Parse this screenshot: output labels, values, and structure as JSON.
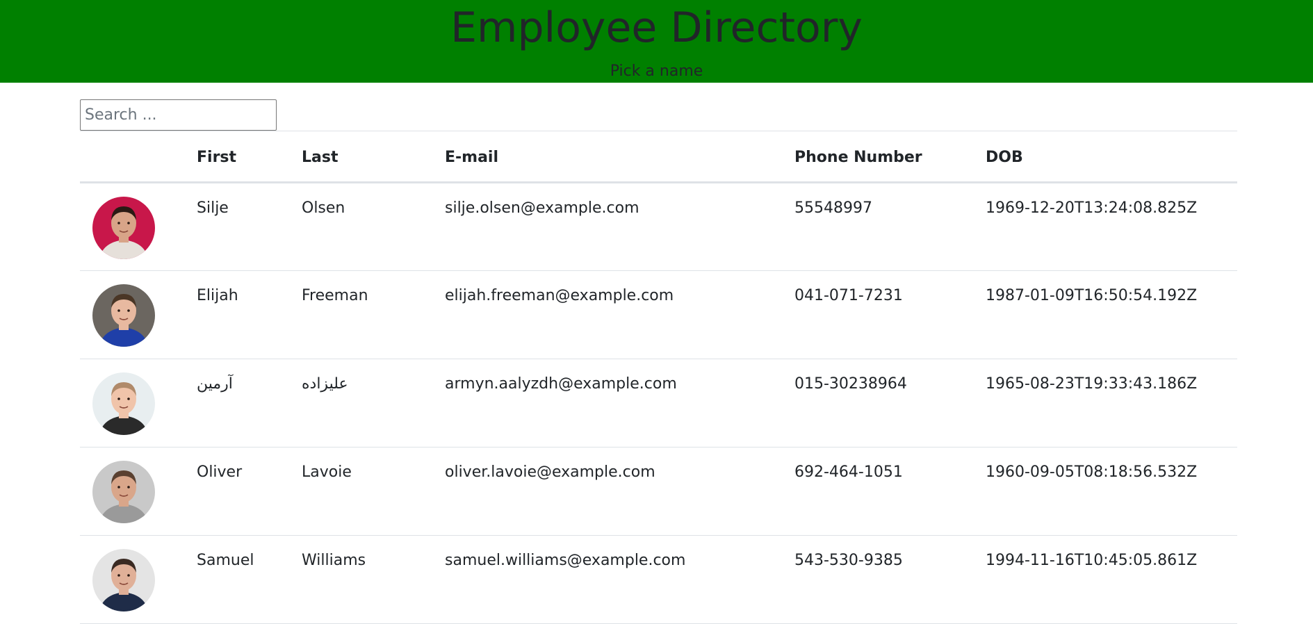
{
  "header": {
    "title": "Employee Directory",
    "subtitle": "Pick a name"
  },
  "search": {
    "placeholder": "Search ...",
    "value": ""
  },
  "table": {
    "columns": [
      "",
      "First",
      "Last",
      "E-mail",
      "Phone Number",
      "DOB"
    ],
    "rows": [
      {
        "first": "Silje",
        "last": "Olsen",
        "email": "silje.olsen@example.com",
        "phone": "55548997",
        "dob": "1969-12-20T13:24:08.825Z",
        "avatar": {
          "bg": "#c8174a",
          "skin": "#d8a488",
          "hair": "#2a1a14",
          "shirt": "#e6e0da"
        }
      },
      {
        "first": "Elijah",
        "last": "Freeman",
        "email": "elijah.freeman@example.com",
        "phone": "041-071-7231",
        "dob": "1987-01-09T16:50:54.192Z",
        "avatar": {
          "bg": "#6b6660",
          "skin": "#e8b9a0",
          "hair": "#4a3626",
          "shirt": "#1f3fa8"
        }
      },
      {
        "first": "آرمین",
        "last": "علیزاده",
        "email": "armyn.aalyzdh@example.com",
        "phone": "015-30238964",
        "dob": "1965-08-23T19:33:43.186Z",
        "avatar": {
          "bg": "#e8eef0",
          "skin": "#f0c4aa",
          "hair": "#b08a6a",
          "shirt": "#2a2a2a"
        }
      },
      {
        "first": "Oliver",
        "last": "Lavoie",
        "email": "oliver.lavoie@example.com",
        "phone": "692-464-1051",
        "dob": "1960-09-05T08:18:56.532Z",
        "avatar": {
          "bg": "#c9c9c9",
          "skin": "#d9a68a",
          "hair": "#5a4030",
          "shirt": "#9a9a9a"
        }
      },
      {
        "first": "Samuel",
        "last": "Williams",
        "email": "samuel.williams@example.com",
        "phone": "543-530-9385",
        "dob": "1994-11-16T10:45:05.861Z",
        "avatar": {
          "bg": "#e4e4e4",
          "skin": "#e0b098",
          "hair": "#3a2a22",
          "shirt": "#1f2c48"
        }
      }
    ]
  },
  "colors": {
    "header_bg": "#008000",
    "row_border": "#dee2e6"
  }
}
